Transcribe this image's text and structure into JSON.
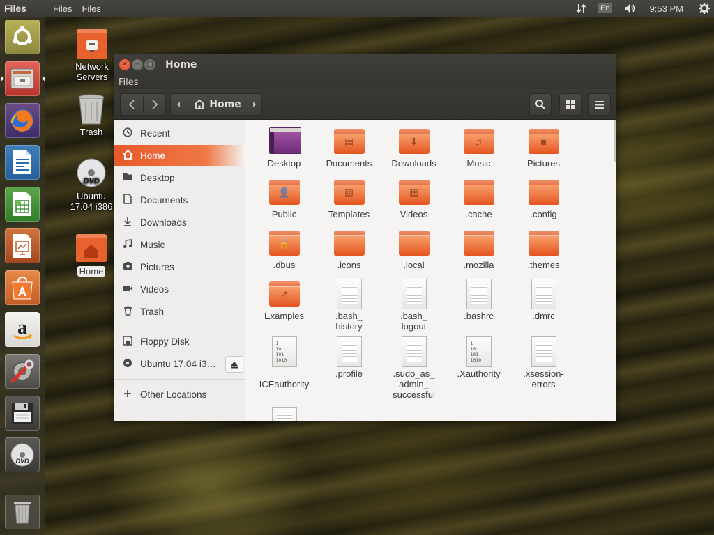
{
  "top_panel": {
    "app_title": "Files",
    "menu": [
      "Files",
      "Files"
    ],
    "language": "En",
    "clock": "9:53 PM"
  },
  "launcher": [
    {
      "name": "ubuntu-dash",
      "icon": "ubuntu-logo-icon"
    },
    {
      "name": "files",
      "icon": "file-cabinet-icon",
      "running": true
    },
    {
      "name": "firefox",
      "icon": "firefox-icon"
    },
    {
      "name": "libreoffice-writer",
      "icon": "writer-icon"
    },
    {
      "name": "libreoffice-calc",
      "icon": "calc-icon"
    },
    {
      "name": "libreoffice-impress",
      "icon": "impress-icon"
    },
    {
      "name": "ubuntu-software",
      "icon": "software-bag-icon"
    },
    {
      "name": "amazon",
      "icon": "amazon-icon"
    },
    {
      "name": "system-settings",
      "icon": "settings-wrench-icon"
    },
    {
      "name": "floppy",
      "icon": "floppy-icon"
    },
    {
      "name": "dvd",
      "icon": "dvd-icon"
    },
    {
      "name": "trash",
      "icon": "trash-icon"
    }
  ],
  "desktop": {
    "icons": [
      {
        "label": "Network\nServers",
        "icon": "network-folder-icon"
      },
      {
        "label": "Trash",
        "icon": "trash-icon"
      },
      {
        "label": "Ubuntu\n17.04 i386",
        "icon": "dvd-icon"
      },
      {
        "label": "Home",
        "icon": "home-folder-icon",
        "selected": true
      }
    ]
  },
  "window": {
    "title": "Home",
    "app_menu": "Files",
    "path_label": "Home",
    "accent": "#e95420",
    "sidebar": {
      "places": [
        {
          "label": "Recent",
          "icon": "clock-icon"
        },
        {
          "label": "Home",
          "icon": "home-icon",
          "active": true
        },
        {
          "label": "Desktop",
          "icon": "folder-icon"
        },
        {
          "label": "Documents",
          "icon": "document-icon"
        },
        {
          "label": "Downloads",
          "icon": "download-icon"
        },
        {
          "label": "Music",
          "icon": "music-icon"
        },
        {
          "label": "Pictures",
          "icon": "camera-icon"
        },
        {
          "label": "Videos",
          "icon": "video-icon"
        },
        {
          "label": "Trash",
          "icon": "trash-icon"
        }
      ],
      "devices": [
        {
          "label": "Floppy Disk",
          "icon": "floppy-icon"
        },
        {
          "label": "Ubuntu 17.04 i3…",
          "icon": "disc-icon"
        }
      ],
      "other": {
        "label": "Other Locations",
        "icon": "plus-icon"
      }
    },
    "files": [
      {
        "label": "Desktop",
        "type": "desktop"
      },
      {
        "label": "Documents",
        "type": "folder",
        "emblem": "▤"
      },
      {
        "label": "Downloads",
        "type": "folder",
        "emblem": "⬇"
      },
      {
        "label": "Music",
        "type": "folder",
        "emblem": "♫"
      },
      {
        "label": "Pictures",
        "type": "folder",
        "emblem": "▣"
      },
      {
        "label": "Public",
        "type": "folder",
        "emblem": "👤"
      },
      {
        "label": "Templates",
        "type": "folder",
        "emblem": "▧"
      },
      {
        "label": "Videos",
        "type": "folder",
        "emblem": "▦"
      },
      {
        "label": ".cache",
        "type": "folder",
        "emblem": ""
      },
      {
        "label": ".config",
        "type": "folder",
        "emblem": ""
      },
      {
        "label": ".dbus",
        "type": "folder",
        "emblem": "🔒"
      },
      {
        "label": ".icons",
        "type": "folder",
        "emblem": ""
      },
      {
        "label": ".local",
        "type": "folder",
        "emblem": ""
      },
      {
        "label": ".mozilla",
        "type": "folder",
        "emblem": ""
      },
      {
        "label": ".themes",
        "type": "folder",
        "emblem": ""
      },
      {
        "label": "Examples",
        "type": "folder",
        "emblem": "↗"
      },
      {
        "label": ".bash_\nhistory",
        "type": "text"
      },
      {
        "label": ".bash_\nlogout",
        "type": "text"
      },
      {
        "label": ".bashrc",
        "type": "text"
      },
      {
        "label": ".dmrc",
        "type": "text"
      },
      {
        "label": ".\nICEauthority",
        "type": "binary"
      },
      {
        "label": ".profile",
        "type": "text"
      },
      {
        "label": ".sudo_as_\nadmin_\nsuccessful",
        "type": "text"
      },
      {
        "label": ".Xauthority",
        "type": "binary"
      },
      {
        "label": ".xsession-\nerrors",
        "type": "text"
      },
      {
        "label": "",
        "type": "text"
      }
    ]
  }
}
